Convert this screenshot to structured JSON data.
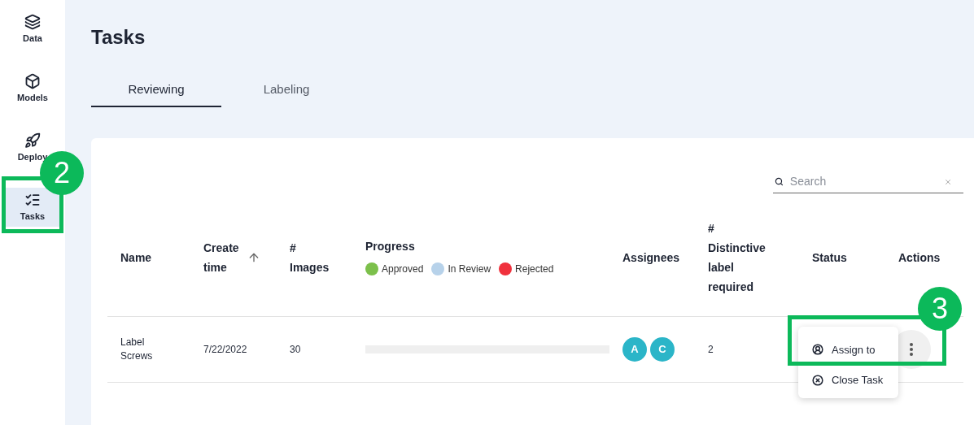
{
  "sidebar": {
    "items": [
      {
        "label": "Data",
        "selected": false
      },
      {
        "label": "Models",
        "selected": false
      },
      {
        "label": "Deploy",
        "selected": false
      },
      {
        "label": "Tasks",
        "selected": true
      }
    ]
  },
  "page_title": "Tasks",
  "tabs": [
    {
      "label": "Reviewing",
      "selected": true
    },
    {
      "label": "Labeling",
      "selected": false
    }
  ],
  "search": {
    "placeholder": "Search"
  },
  "table": {
    "columns": [
      {
        "label": "Name",
        "sorted": false
      },
      {
        "label": "Create time",
        "sorted": true
      },
      {
        "label": "# Images",
        "sorted": false
      },
      {
        "label": "Progress",
        "sorted": false,
        "legend": [
          {
            "label": "Approved",
            "color": "#7cc04b"
          },
          {
            "label": "In Review",
            "color": "#b7d2ea"
          },
          {
            "label": "Rejected",
            "color": "#f0313d"
          }
        ]
      },
      {
        "label": "Assignees",
        "sorted": false
      },
      {
        "label": "# Distinctive label required",
        "sorted": false
      },
      {
        "label": "Status",
        "sorted": false
      },
      {
        "label": "Actions",
        "sorted": false
      }
    ],
    "rows": [
      {
        "name": "Label Screws",
        "create_time": "7/22/2022",
        "images": "30",
        "progress": {
          "level": 0
        },
        "assignees": [
          "A",
          "C"
        ],
        "distinctive_labels": "2"
      }
    ]
  },
  "actions_menu": [
    {
      "label": "Assign to"
    },
    {
      "label": "Close Task"
    }
  ],
  "callouts": [
    "2",
    "3"
  ]
}
